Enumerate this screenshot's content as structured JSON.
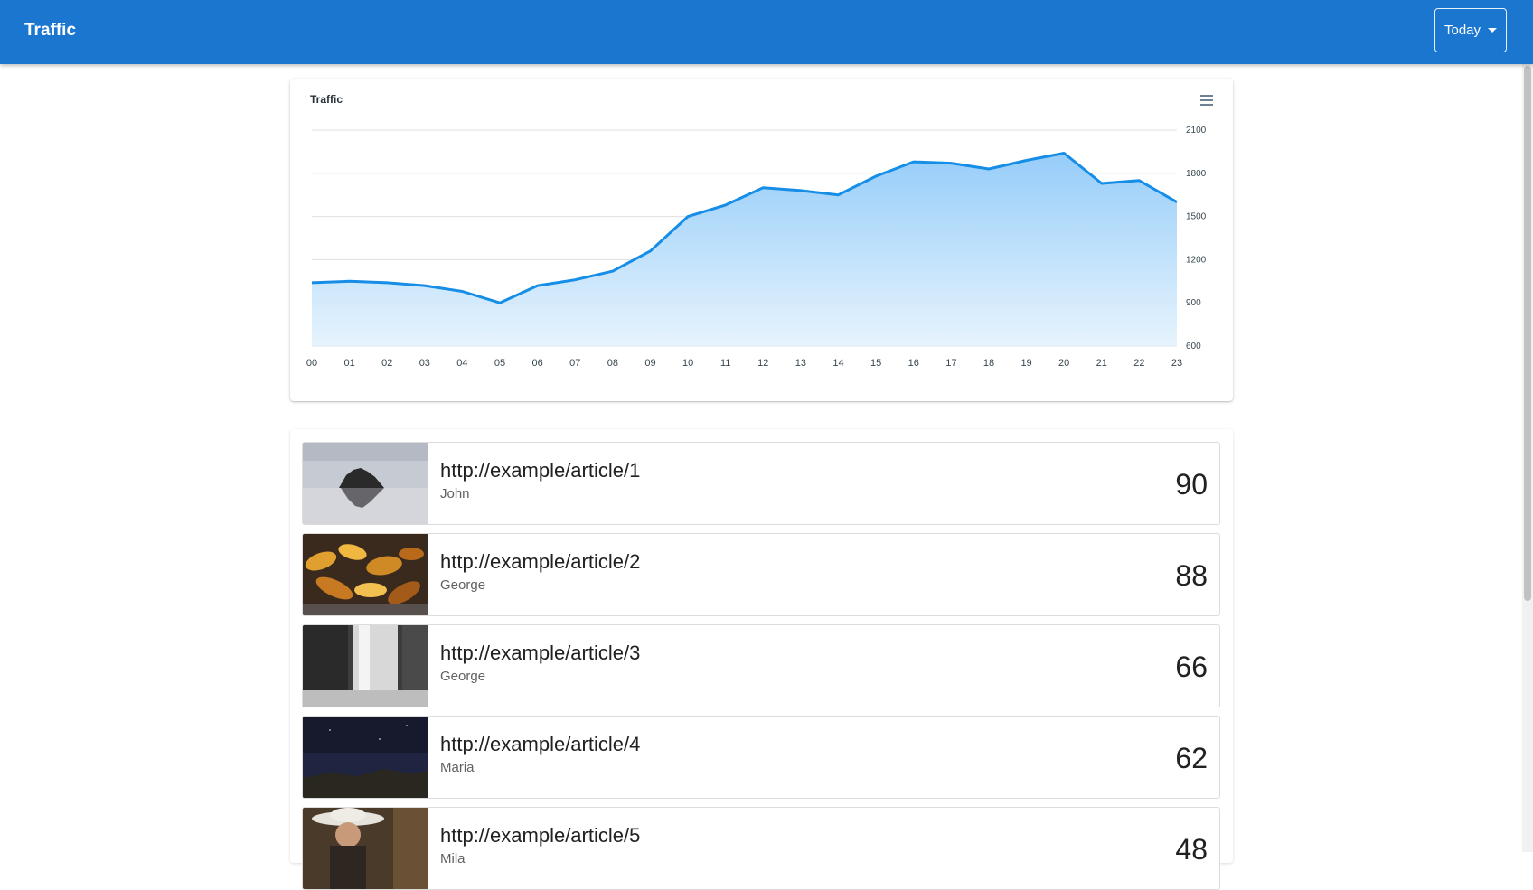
{
  "app": {
    "title": "Traffic",
    "period": "Today"
  },
  "colors": {
    "appbar": "#1b76d0",
    "line": "#168de6",
    "fill": "#90caf9"
  },
  "chart_data": {
    "type": "area",
    "title": "Traffic",
    "x": [
      "00",
      "01",
      "02",
      "03",
      "04",
      "05",
      "06",
      "07",
      "08",
      "09",
      "10",
      "11",
      "12",
      "13",
      "14",
      "15",
      "16",
      "17",
      "18",
      "19",
      "20",
      "21",
      "22",
      "23"
    ],
    "series": [
      {
        "values": [
          1040,
          1050,
          1040,
          1020,
          980,
          900,
          1020,
          1060,
          1120,
          1260,
          1500,
          1580,
          1700,
          1680,
          1650,
          1780,
          1880,
          1870,
          1830,
          1890,
          1940,
          1730,
          1750,
          1600
        ]
      }
    ],
    "ylim": [
      600,
      2100
    ],
    "yticks": [
      600,
      900,
      1200,
      1500,
      1800,
      2100
    ],
    "y_axis_position": "right",
    "grid": true,
    "menu_icon": "hamburger-menu-icon"
  },
  "articles": [
    {
      "url": "http://example/article/1",
      "author": "John",
      "count": "90",
      "image": "rock-island-reflection"
    },
    {
      "url": "http://example/article/2",
      "author": "George",
      "count": "88",
      "image": "autumn-leaves"
    },
    {
      "url": "http://example/article/3",
      "author": "George",
      "count": "66",
      "image": "waterfall-bw"
    },
    {
      "url": "http://example/article/4",
      "author": "Maria",
      "count": "62",
      "image": "night-sky"
    },
    {
      "url": "http://example/article/5",
      "author": "Mila",
      "count": "48",
      "image": "woman-with-hat"
    }
  ]
}
